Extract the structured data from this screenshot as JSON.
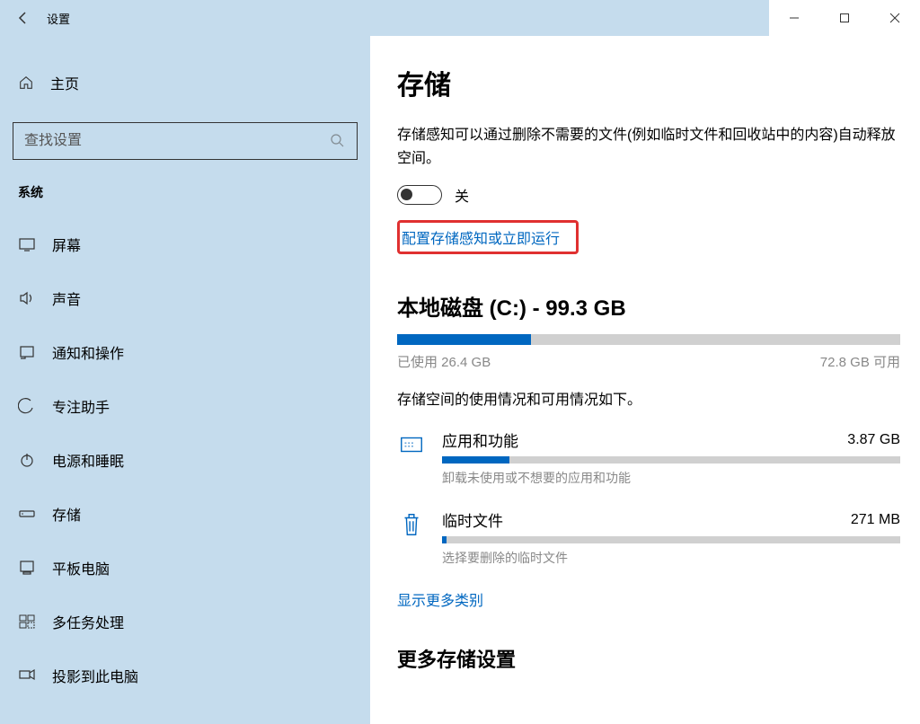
{
  "titlebar": {
    "title": "设置"
  },
  "sidebar": {
    "home": "主页",
    "search_placeholder": "查找设置",
    "section": "系统",
    "items": [
      {
        "label": "屏幕"
      },
      {
        "label": "声音"
      },
      {
        "label": "通知和操作"
      },
      {
        "label": "专注助手"
      },
      {
        "label": "电源和睡眠"
      },
      {
        "label": "存储"
      },
      {
        "label": "平板电脑"
      },
      {
        "label": "多任务处理"
      },
      {
        "label": "投影到此电脑"
      }
    ]
  },
  "main": {
    "title": "存储",
    "description": "存储感知可以通过删除不需要的文件(例如临时文件和回收站中的内容)自动释放空间。",
    "toggle_state": "关",
    "config_link": "配置存储感知或立即运行",
    "disk": {
      "heading": "本地磁盘 (C:) - 99.3 GB",
      "used_label": "已使用 26.4 GB",
      "free_label": "72.8 GB 可用",
      "used_percent": 26.6,
      "description": "存储空间的使用情况和可用情况如下。"
    },
    "categories": [
      {
        "name": "应用和功能",
        "size": "3.87 GB",
        "percent": 14.7,
        "hint": "卸载未使用或不想要的应用和功能"
      },
      {
        "name": "临时文件",
        "size": "271 MB",
        "percent": 1.0,
        "hint": "选择要删除的临时文件"
      }
    ],
    "show_more": "显示更多类别",
    "more_heading": "更多存储设置"
  }
}
